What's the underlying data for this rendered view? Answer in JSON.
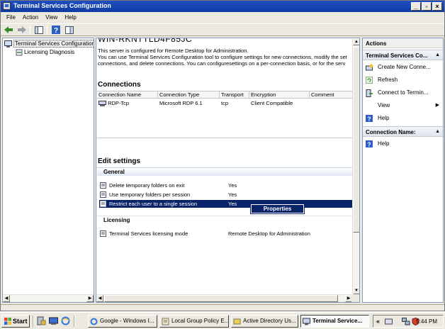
{
  "window": {
    "title": "Terminal Services Configuration"
  },
  "menu": [
    "File",
    "Action",
    "View",
    "Help"
  ],
  "tree": {
    "root": "Terminal Services Configuration:",
    "child": "Licensing Diagnosis"
  },
  "main": {
    "server_name": "WIN-RKNTTLD4F85JC",
    "description_lines": [
      "This server is configured for Remote Desktop for Administration.",
      "You can use Terminal Services Configuration tool to configure settings for new connections, modify the set",
      "connections, and delete connections. You can configuresettings on a per-connection basis, or for the serv"
    ],
    "connections_heading": "Connections",
    "connections_columns": [
      "Connection Name",
      "Connection Type",
      "Transport",
      "Encryption",
      "Comment"
    ],
    "connections_rows": [
      {
        "name": "RDP-Tcp",
        "type": "Microsoft RDP 6.1",
        "transport": "tcp",
        "encryption": "Client Compatible",
        "comment": ""
      }
    ],
    "edit_heading": "Edit settings",
    "general_label": "General",
    "general_settings": [
      {
        "name": "Delete temporary folders on exit",
        "value": "Yes"
      },
      {
        "name": "Use temporary folders per session",
        "value": "Yes"
      },
      {
        "name": "Restrict each user to a single session",
        "value": "Yes"
      }
    ],
    "licensing_label": "Licensing",
    "licensing_settings": [
      {
        "name": "Terminal Services licensing mode",
        "value": "Remote Desktop for Administration"
      }
    ],
    "context_menu_item": "Properties"
  },
  "actions": {
    "title": "Actions",
    "group1": "Terminal Services Co...",
    "items1": [
      "Create New Conne...",
      "Refresh",
      "Connect to Termin...",
      "View",
      "Help"
    ],
    "group2": "Connection Name:",
    "items2": [
      "Help"
    ]
  },
  "taskbar": {
    "start": "Start",
    "tasks": [
      "Google - Windows I...",
      "Local Group Policy E...",
      "Active Directory Us...",
      "Terminal Service..."
    ],
    "clock": "5:44 PM"
  },
  "colors": {
    "titlebar": "#0e3aa3",
    "selection": "#0a246a"
  }
}
